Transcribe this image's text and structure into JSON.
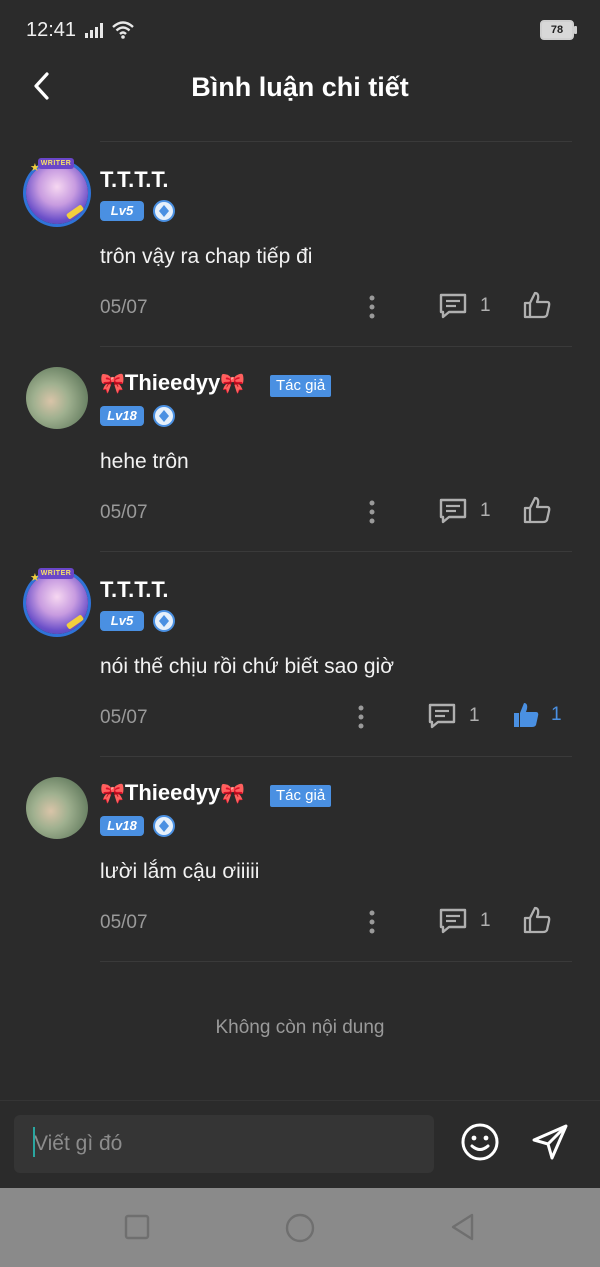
{
  "status": {
    "time": "12:41",
    "battery": "78"
  },
  "header": {
    "title": "Bình luận chi tiết"
  },
  "comments": [
    {
      "user": "T.T.T.T.",
      "level": "Lv5",
      "avatar_badge": "WRITER",
      "text": "trôn vậy ra chap tiếp đi",
      "date": "05/07",
      "replies": "1",
      "likes": "",
      "liked": false
    },
    {
      "user": "Thieedyy",
      "author_tag": "Tác giả",
      "level": "Lv18",
      "text": "hehe trôn",
      "date": "05/07",
      "replies": "1",
      "likes": "",
      "liked": false
    },
    {
      "user": "T.T.T.T.",
      "level": "Lv5",
      "avatar_badge": "WRITER",
      "text": "nói thế chịu rồi chứ biết sao giờ",
      "date": "05/07",
      "replies": "1",
      "likes": "1",
      "liked": true
    },
    {
      "user": "Thieedyy",
      "author_tag": "Tác giả",
      "level": "Lv18",
      "text": "lười lắm cậu ơiiiii",
      "date": "05/07",
      "replies": "1",
      "likes": "",
      "liked": false
    }
  ],
  "footer": {
    "end_text": "Không còn nội dung"
  },
  "composer": {
    "placeholder": "Viết gì đó"
  },
  "colors": {
    "background": "#2b2b2b",
    "accent": "#4a90e2",
    "muted": "#9a9a9a"
  }
}
